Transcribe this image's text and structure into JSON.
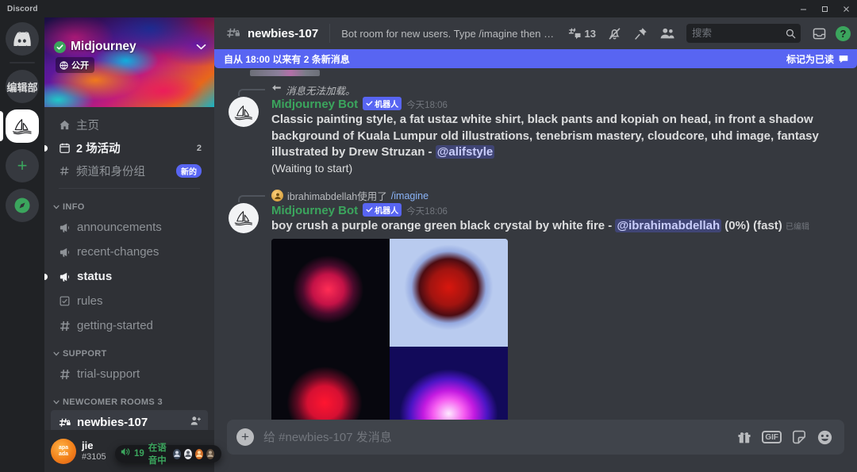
{
  "window": {
    "app_title": "Discord",
    "minimize": "minimize-button",
    "maximize": "maximize-button",
    "close": "close-button"
  },
  "rail": {
    "items": [
      {
        "name": "discord-home",
        "label": "",
        "icon": "discord-logo-icon",
        "active": false
      },
      {
        "name": "server-bianjibu",
        "label": "编辑部",
        "icon": "text-avatar",
        "active": false
      },
      {
        "name": "server-midjourney",
        "label": "",
        "icon": "midjourney-sailboat-icon",
        "active": true
      },
      {
        "name": "add-server",
        "label": "+",
        "icon": "plus-icon",
        "active": false
      },
      {
        "name": "explore-servers",
        "label": "",
        "icon": "compass-icon",
        "active": false
      }
    ]
  },
  "sidebar": {
    "server_name": "Midjourney",
    "verified": true,
    "public_label": "公开",
    "nav": [
      {
        "label": "主页",
        "icon": "home-icon",
        "count": "",
        "badge": "",
        "unread": false
      },
      {
        "label": "2 场活动",
        "icon": "calendar-icon",
        "count": "2",
        "badge": "",
        "unread": true
      },
      {
        "label": "频道和身份组",
        "icon": "channels-roles-icon",
        "count": "",
        "badge": "新的",
        "unread": false
      }
    ],
    "categories": [
      {
        "name": "INFO",
        "channels": [
          {
            "label": "announcements",
            "icon": "announcement-icon",
            "state": "normal"
          },
          {
            "label": "recent-changes",
            "icon": "announcement-icon",
            "state": "normal"
          },
          {
            "label": "status",
            "icon": "announcement-icon",
            "state": "unread"
          },
          {
            "label": "rules",
            "icon": "rules-icon",
            "state": "normal"
          },
          {
            "label": "getting-started",
            "icon": "hash-icon",
            "state": "normal"
          }
        ]
      },
      {
        "name": "SUPPORT",
        "channels": [
          {
            "label": "trial-support",
            "icon": "hash-icon",
            "state": "normal"
          }
        ]
      },
      {
        "name": "NEWCOMER ROOMS 3",
        "channels": [
          {
            "label": "newbies-107",
            "icon": "hash-lock-icon",
            "state": "selected",
            "action": "invite-icon"
          },
          {
            "label": "",
            "icon": "hash-lock-icon",
            "state": "unread"
          }
        ]
      }
    ],
    "voice_pill": {
      "count": "19",
      "label": "在语音中",
      "icon": "speaker-icon",
      "avatars": [
        "🎮",
        "🤖",
        "🎃",
        "🐘"
      ]
    },
    "user": {
      "avatar_text": "apa\nada",
      "name": "jie",
      "tag": "#3105",
      "controls": [
        "microphone-icon",
        "headphones-icon",
        "settings-gear-icon"
      ]
    }
  },
  "header": {
    "channel_name": "newbies-107",
    "topic": "Bot room for new users. Type /imagine then describe what y...",
    "threads_count": "13",
    "icons": [
      "threads-icon",
      "bell-off-icon",
      "pin-icon",
      "members-icon"
    ],
    "search": {
      "placeholder": "搜索",
      "value": ""
    },
    "inbox_icon": "inbox-icon",
    "help_icon": "help-icon"
  },
  "new_messages_banner": {
    "text": "自从 18:00 以来有 2 条新消息",
    "mark_read": "标记为已读",
    "mark_read_icon": "mark-read-icon",
    "color": "#5865f2"
  },
  "messages": [
    {
      "reply_ref": {
        "type": "unavailable",
        "text": "消息无法加载。",
        "icon": "reply-arrow-icon"
      },
      "author": "Midjourney Bot",
      "bot_badge": "机器人",
      "timestamp_day": "今天",
      "timestamp_time": "18:06",
      "avatar_icon": "midjourney-sailboat-icon",
      "content_parts": [
        {
          "t": "text",
          "v": "Classic painting style, a fat ustaz white shirt, black pants and kopiah on head, in front a shadow background of Kuala Lumpur old illustrations, tenebrism mastery, cloudcore, uhd image, fantasy illustrated by Drew Struzan - "
        },
        {
          "t": "mention",
          "v": "@alifstyle"
        }
      ],
      "sub_text": "(Waiting to start)",
      "images": []
    },
    {
      "reply_ref": {
        "type": "command",
        "user": "ibrahimabdellah",
        "used_text": "使用了",
        "command": "/imagine",
        "icon": "user-avatar-icon"
      },
      "author": "Midjourney Bot",
      "bot_badge": "机器人",
      "timestamp_day": "今天",
      "timestamp_time": "18:06",
      "avatar_icon": "midjourney-sailboat-icon",
      "content_parts": [
        {
          "t": "text",
          "v": "boy crush a purple orange green black crystal by white fire - "
        },
        {
          "t": "mention",
          "v": "@ibrahimabdellah"
        },
        {
          "t": "plain",
          "v": " (0%) (fast) "
        },
        {
          "t": "edited",
          "v": "已编辑"
        }
      ],
      "sub_text": "",
      "images": [
        {
          "name": "preview-tile-1",
          "alt": "red crystal on black"
        },
        {
          "name": "preview-tile-2",
          "alt": "red sphere on blue"
        },
        {
          "name": "preview-tile-3",
          "alt": "red orb on black"
        },
        {
          "name": "preview-tile-4",
          "alt": "magenta glow on blue"
        }
      ]
    }
  ],
  "composer": {
    "placeholder": "给 #newbies-107 发消息",
    "value": "",
    "plus_icon": "add-attachment-icon",
    "buttons": [
      "gift-icon",
      "gif-icon",
      "sticker-icon",
      "emoji-icon"
    ],
    "gif_label": "GIF"
  }
}
